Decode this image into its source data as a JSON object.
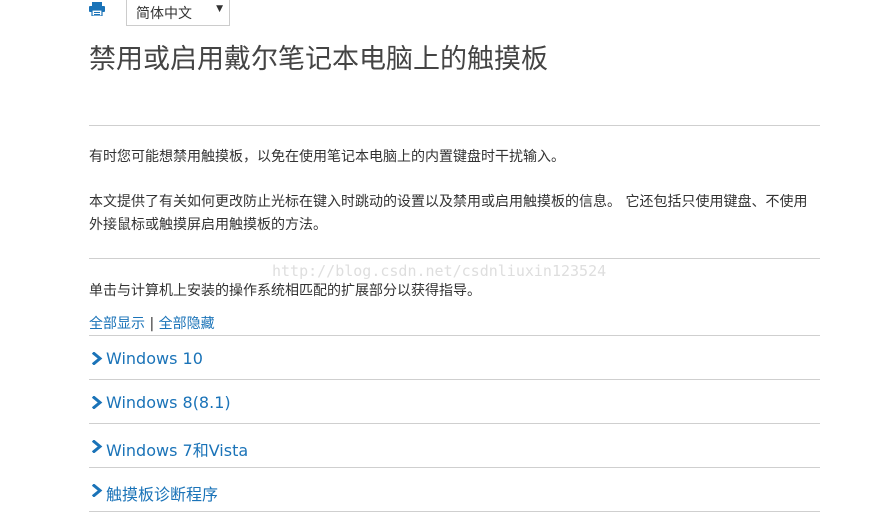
{
  "toolbar": {
    "print_icon": "print-icon",
    "language_selected": "简体中文",
    "language_caret": "▼"
  },
  "article": {
    "title": "禁用或启用戴尔笔记本电脑上的触摸板",
    "paragraphs": [
      "有时您可能想禁用触摸板，以免在使用笔记本电脑上的内置键盘时干扰输入。",
      "本文提供了有关如何更改防止光标在键入时跳动的设置以及禁用或启用触摸板的信息。 它还包括只使用键盘、不使用外接鼠标或触摸屏启用触摸板的方法。",
      "单击与计算机上安装的操作系统相匹配的扩展部分以获得指导。"
    ],
    "watermark": "http://blog.csdn.net/csdnliuxin123524"
  },
  "toggles": {
    "show_all": "全部显示",
    "separator": " | ",
    "hide_all": "全部隐藏"
  },
  "sections": [
    {
      "label": "Windows 10"
    },
    {
      "label": "Windows 8(8.1)"
    },
    {
      "label": "Windows 7和Vista"
    },
    {
      "label": "触摸板诊断程序"
    }
  ],
  "colors": {
    "link": "#1a73b8",
    "text": "#333333",
    "rule": "#cfcfcf"
  }
}
